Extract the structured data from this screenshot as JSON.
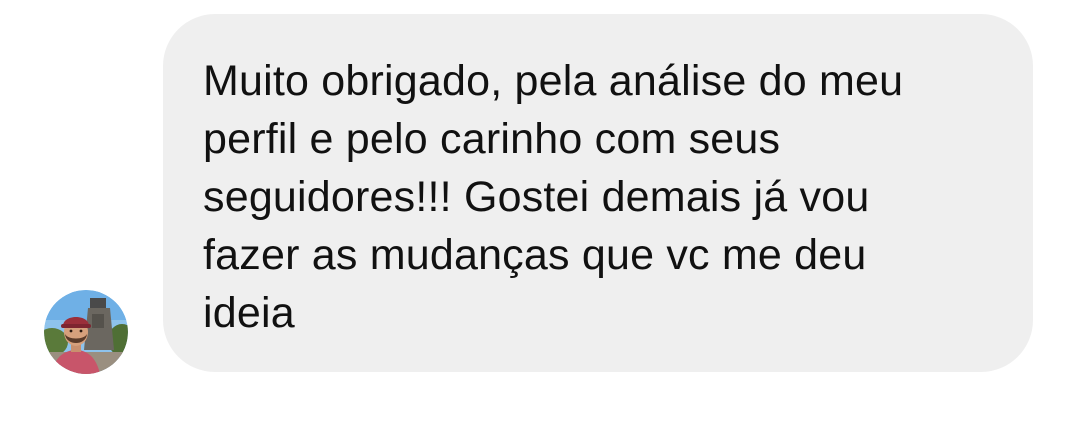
{
  "conversation": {
    "messages": [
      {
        "sender_avatar": "profile-photo-man-with-red-cap",
        "text": "Muito obrigado, pela análise do meu\nperfil e pelo carinho com seus\nseguidores!!! Gostei demais já vou\nfazer as mudanças que vc me deu\nideia"
      }
    ]
  },
  "colors": {
    "background": "#ffffff",
    "bubble": "#efefef",
    "text": "#111111"
  }
}
